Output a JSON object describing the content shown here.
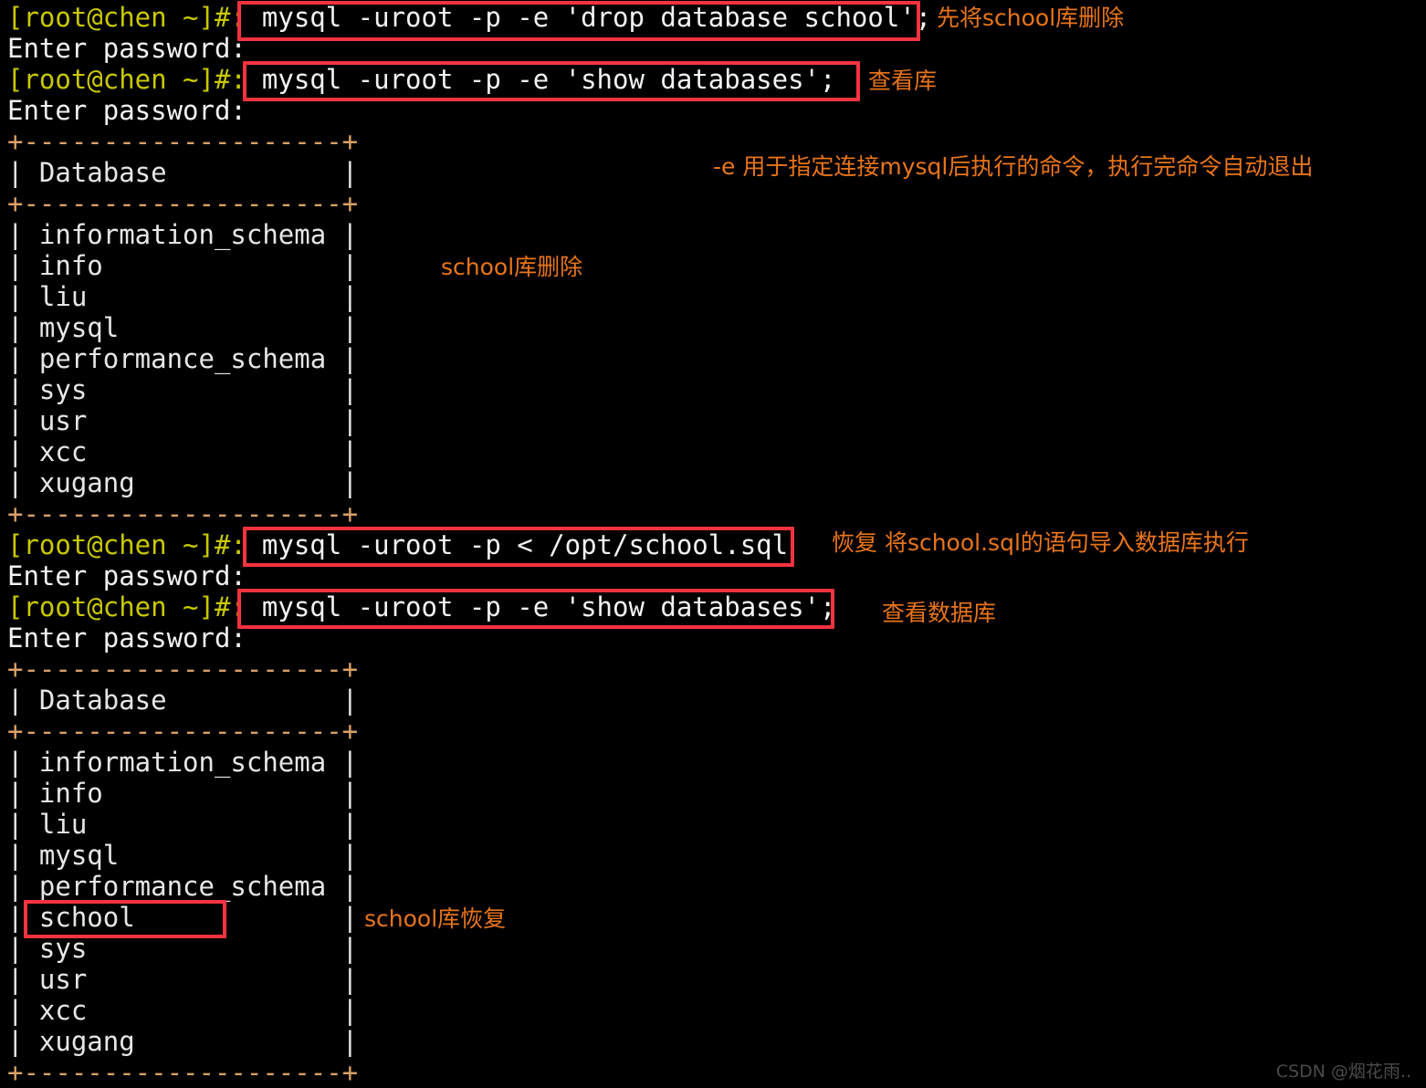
{
  "terminal": {
    "prompt": "[root@chen ~]#:",
    "password_prompt": "Enter password:",
    "table_rule": "+--------------------+",
    "table_header": "| Database           |",
    "commands": {
      "drop_school": "mysql -uroot -p -e 'drop database school';",
      "show_databases_1": "mysql -uroot -p -e 'show databases';",
      "restore_school": "mysql -uroot -p < /opt/school.sql",
      "show_databases_2": "mysql -uroot -p -e 'show databases';"
    },
    "databases_before": [
      "| information_schema |",
      "| info               |",
      "| liu                |",
      "| mysql              |",
      "| performance_schema |",
      "| sys                |",
      "| usr                |",
      "| xcc                |",
      "| xugang             |"
    ],
    "databases_after": [
      "| information_schema |",
      "| info               |",
      "| liu                |",
      "| mysql              |",
      "| performance_schema |",
      "| school             |",
      "| sys                |",
      "| usr                |",
      "| xcc                |",
      "| xugang             |"
    ]
  },
  "annotations": {
    "drop_school": "先将school库删除",
    "show_db": "查看库",
    "e_option": "-e 用于指定连接mysql后执行的命令，执行完命令自动退出",
    "school_dropped": "school库删除",
    "restore": "恢复 将school.sql的语句导入数据库执行",
    "view_db": "查看数据库",
    "school_restored": "school库恢复"
  },
  "watermark": "CSDN @烟花雨..",
  "colors": {
    "background": "#000000",
    "prompt": "#c8c800",
    "text": "#e6e6e6",
    "table_rule": "#d9a066",
    "highlight_box": "#f5333f",
    "annotation": "#e8751a"
  }
}
